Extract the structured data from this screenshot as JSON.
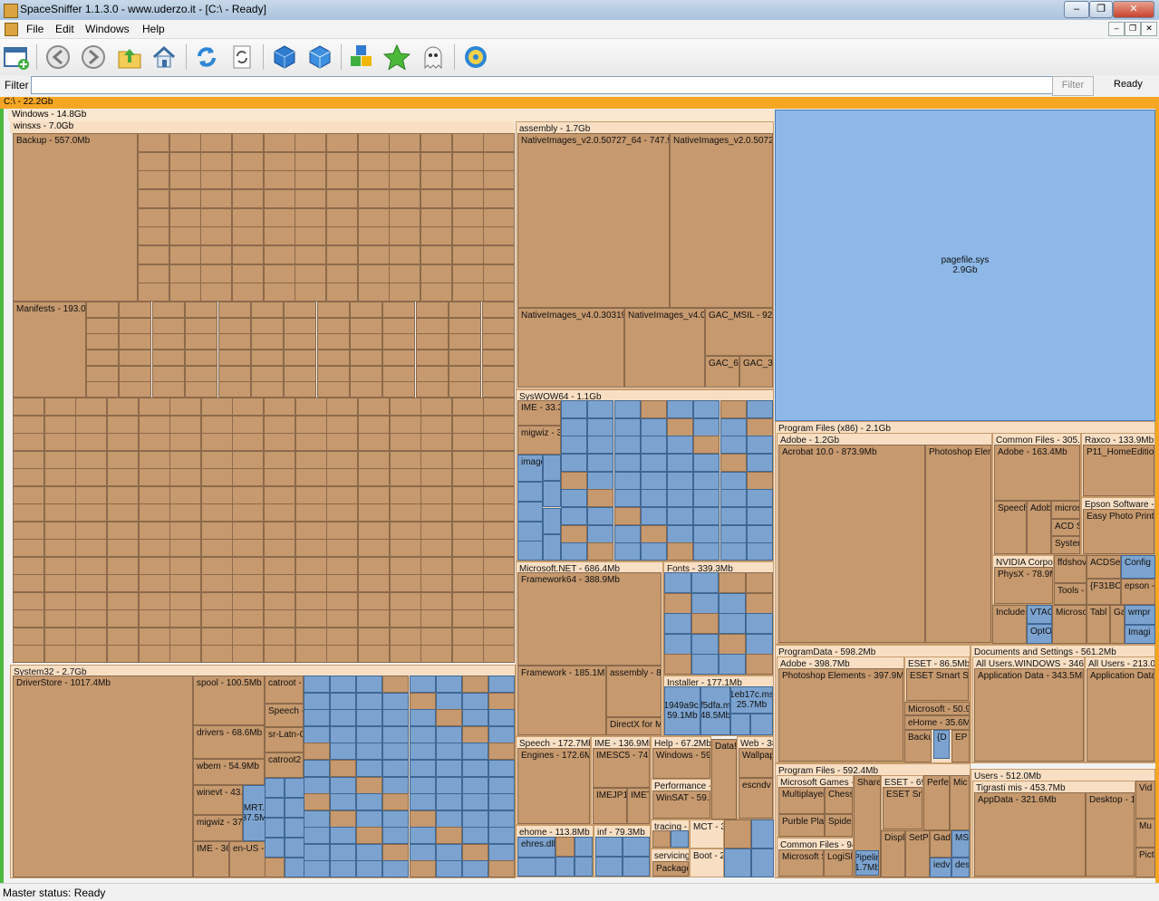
{
  "window": {
    "title": "SpaceSniffer 1.1.3.0 - www.uderzo.it - [C:\\ - Ready]",
    "controls": {
      "minimize": "–",
      "maximize": "❐",
      "close": "✕"
    }
  },
  "menu": {
    "file": "File",
    "edit": "Edit",
    "windows": "Windows",
    "help": "Help",
    "mdi": {
      "minimize": "–",
      "restore": "❐",
      "close": "✕"
    }
  },
  "toolbar": {
    "icons": [
      "new-view-icon",
      "back-icon",
      "forward-icon",
      "parent-folder-icon",
      "home-icon",
      "refresh-icon",
      "rescan-icon",
      "zoom-in-cube-icon",
      "zoom-out-cube-icon",
      "cubes-icon",
      "favorite-star-icon",
      "ghost-icon",
      "settings-gear-icon"
    ]
  },
  "filter": {
    "label": "Filter",
    "value": "",
    "button": "Filter",
    "status": "Ready"
  },
  "colors": {
    "folder": "#c6996e",
    "file": "#7ca3cf",
    "header": "#f8dfc4",
    "root": "#f5a623",
    "selection": "#4cbb3c"
  },
  "treemap": {
    "root": "C:\\ - 22.2Gb",
    "windows": "Windows - 14.8Gb",
    "winsxs": "winsxs - 7.0Gb",
    "backup": "Backup - 557.0Mb",
    "manifests": "Manifests - 193.0Mb",
    "assembly": "assembly - 1.7Gb",
    "nativeimages_v2": "NativeImages_v2.0.50727_64 - 747.9Mb",
    "nativeimages_v2b": "NativeImages_v2.0.50727",
    "nativeimages_v4": "NativeImages_v4.0.30319_",
    "nativeimages_v4b": "NativeImages_v4.0.",
    "gac_msil": "GAC_MSIL - 92.",
    "gac_64": "GAC_64",
    "gac_3": "GAC_3",
    "syswow64": "SysWOW64 - 1.1Gb",
    "ime_sw": "IME - 33.3",
    "migwiz_sw": "migwiz - 3.",
    "image_sw": "image 19.3M",
    "microsoft_net": "Microsoft.NET - 686.4Mb",
    "framework64": "Framework64 - 388.9Mb",
    "framework": "Framework - 185.1Mb",
    "assembly2": "assembly - 83",
    "directx": "DirectX for M",
    "fonts": "Fonts - 339.3Mb",
    "installer": "Installer - 177.1Mb",
    "installer_1949": "1949a9c. 59.1Mb",
    "installer_f5dfa": "f5dfa.m 48.5Mb",
    "installer_1eb": "1eb17c.ms 25.7Mb",
    "speech": "Speech - 172.7Mb",
    "engines": "Engines - 172.6Mb",
    "ime_win": "IME - 136.9Mb",
    "imesc5": "IMESC5 - 74.",
    "imejp": "IMEJP1(",
    "imet": "IMET",
    "help": "Help - 67.2Mb",
    "help_windows": "Windows - 59.",
    "performance": "Performance - 5",
    "winsat": "WinSAT - 59.7",
    "ehome": "ehome - 113.8Mb",
    "ehres": "ehres.dll",
    "inf": "inf - 79.3Mb",
    "tracing": "tracing - 3",
    "mct": "MCT - 3",
    "servicing": "servicing",
    "package": "Package",
    "boot": "Boot - 27",
    "web": "Web - 38",
    "wallpaper": "Wallpap",
    "escndv": "escndv",
    "system32": "System32 - 2.7Gb",
    "driverstore": "DriverStore - 1017.4Mb",
    "spool": "spool - 100.5Mb",
    "catroot": "catroot - 5",
    "catroot2": "catroot2",
    "drivers": "drivers - 68.6Mb",
    "wbem": "wbem - 54.9Mb",
    "winevt": "winevt - 43.",
    "migwiz": "migwiz - 37.",
    "ime_sys": "IME - 36",
    "en_us": "en-US - 3",
    "speech_sys": "Speech -",
    "sr_latn": "sr-Latn-C",
    "mrt": "MRT. 37.5M",
    "pagefile": "pagefile.sys",
    "pagefile_size": "2.9Gb",
    "pf_x86": "Program Files (x86) - 2.1Gb",
    "adobe_x86": "Adobe - 1.2Gb",
    "acrobat": "Acrobat 10.0 - 873.9Mb",
    "photoshop_x86": "Photoshop Eleme",
    "common_files": "Common Files - 305.6Mb",
    "cf_adobe": "Adobe - 163.4Mb",
    "raxco": "Raxco - 133.9Mb",
    "p11": "P11_HomeEdition",
    "epson": "Epson Software - 1",
    "easy_photo": "Easy Photo Print",
    "nvidia": "NVIDIA Corpo",
    "physx": "PhysX - 78.9M",
    "programdata": "ProgramData - 598.2Mb",
    "pd_adobe": "Adobe - 398.7Mb",
    "pd_photoshop": "Photoshop Elements - 397.9Mb",
    "eset": "ESET - 86.5Mb",
    "eset_smart": "ESET Smart Se",
    "pd_microsoft": "Microsoft - 50.9",
    "ehome_pd": "eHome - 35.6M",
    "docs_settings": "Documents and Settings - 561.2Mb",
    "all_users_windows": "All Users.WINDOWS - 346.2",
    "app_data1": "Application Data - 343.5Mb",
    "all_users": "All Users - 213.0M",
    "app_data2": "Application Data",
    "program_files": "Program Files - 592.4Mb",
    "ms_games": "Microsoft Games - 1",
    "multiplayer": "Multiplayer",
    "chess": "Chess",
    "purble": "Purble Place",
    "spider": "Spider",
    "common_files2": "Common Files - 94.",
    "ms_s": "Microsoft S",
    "logishr": "LogiShr",
    "share": "Share",
    "eset2": "ESET - 69",
    "eset_sm2": "ESET Sm",
    "perfe": "Perfe",
    "mic": "Mic",
    "pipeline": "Pipelin 1.7Mb",
    "users": "Users - 512.0Mb",
    "tigrasti": "Tigrasti mis - 453.7Mb",
    "appdata": "AppData - 321.6Mb",
    "desktop": "Desktop - 1"
  },
  "status": {
    "text": "Master status: Ready"
  }
}
